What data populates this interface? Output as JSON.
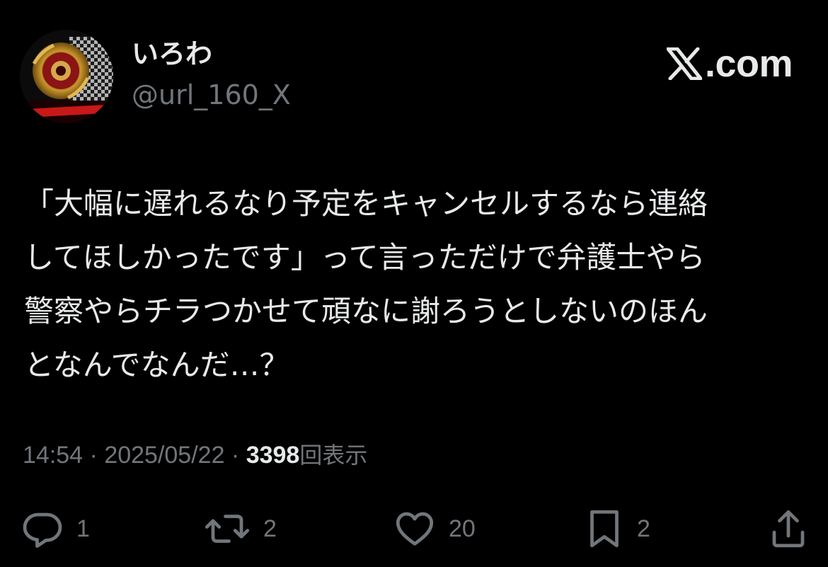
{
  "author": {
    "display_name": "いろわ",
    "handle": "@url_160_X",
    "avatar_icon": "beyblade-avatar"
  },
  "site": {
    "icon": "x-logo-icon",
    "domain_text": ".com"
  },
  "tweet": {
    "text": "「大幅に遅れるなり予定をキャンセルするなら連絡\nしてほしかったです」って言っただけで弁護士やら\n警察やらチラつかせて頑なに謝ろうとしないのほん\nとなんでなんだ…？"
  },
  "meta": {
    "time": "14:54",
    "separator": " · ",
    "date": "2025/05/22",
    "views_count": "3398",
    "views_label": "回表示"
  },
  "actions": {
    "reply": {
      "icon": "reply-icon",
      "count": "1"
    },
    "retweet": {
      "icon": "retweet-icon",
      "count": "2"
    },
    "like": {
      "icon": "heart-icon",
      "count": "20"
    },
    "bookmark": {
      "icon": "bookmark-icon",
      "count": "2"
    },
    "share": {
      "icon": "share-icon"
    }
  },
  "colors": {
    "background": "#000000",
    "primary_text": "#e7e9ea",
    "secondary_text": "#71767b"
  }
}
